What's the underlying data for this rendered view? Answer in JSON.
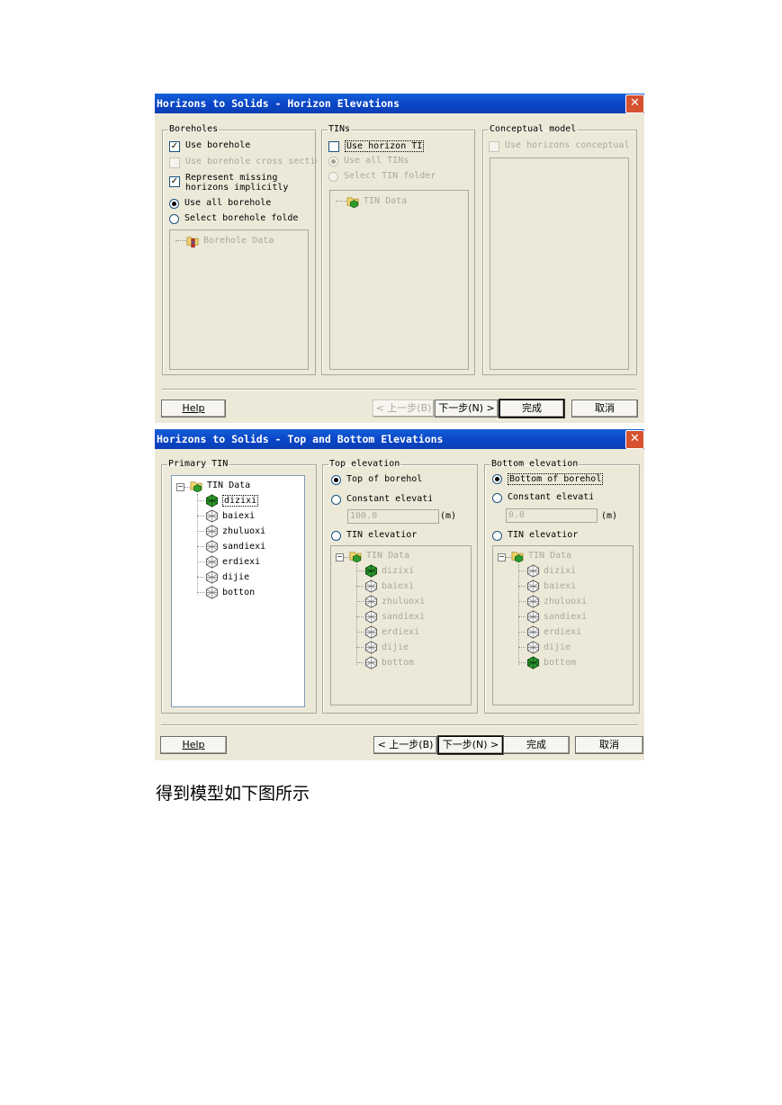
{
  "dialog1": {
    "title": "Horizons to Solids - Horizon Elevations",
    "close_glyph": "✕",
    "boreholes": {
      "legend": "Boreholes",
      "use_borehole": "Use borehole",
      "use_cross_sections": "Use borehole cross sectior",
      "represent_missing_line1": "Represent missing",
      "represent_missing_line2": "horizons implicitly",
      "use_all": "Use all borehole",
      "select_folder": "Select borehole folde",
      "tree_root": "Borehole Data"
    },
    "tins": {
      "legend": "TINs",
      "use_horizon": "Use horizon TI",
      "use_all": "Use all TINs",
      "select_folder": "Select TIN folder",
      "tree_root": "TIN Data"
    },
    "conceptual": {
      "legend": "Conceptual model",
      "use_horizons": "Use horizons conceptual m"
    },
    "buttons": {
      "help": "Help",
      "back": "< 上一步(B)",
      "next": "下一步(N) >",
      "finish": "完成",
      "cancel": "取消"
    }
  },
  "dialog2": {
    "title": "Horizons to Solids - Top and Bottom Elevations",
    "close_glyph": "✕",
    "primary": {
      "legend": "Primary TIN",
      "root": "TIN Data",
      "expander": "−",
      "items": [
        "dizixi",
        "baiexi",
        "zhuluoxi",
        "sandiexi",
        "erdiexi",
        "dijie",
        "botton"
      ]
    },
    "top": {
      "legend": "Top elevation",
      "top_of_borehole": "Top of borehol",
      "constant": "Constant elevati",
      "constant_value": "100.0",
      "unit": "(m)",
      "tin_elevation": "TIN elevatior",
      "tree_root": "TIN Data",
      "expander": "−",
      "items": [
        "dizixi",
        "baiexi",
        "zhuluoxi",
        "sandiexi",
        "erdiexi",
        "dijie",
        "bottom"
      ]
    },
    "bottom": {
      "legend": "Bottom elevation",
      "bottom_of_borehole": "Bottom of borehol",
      "constant": "Constant elevati",
      "constant_value": "0.0",
      "unit": "(m)",
      "tin_elevation": "TIN elevatior",
      "tree_root": "TIN Data",
      "expander": "−",
      "items": [
        "dizixi",
        "baiexi",
        "zhuluoxi",
        "sandiexi",
        "erdiexi",
        "dijie",
        "bottom"
      ]
    },
    "buttons": {
      "help": "Help",
      "back": "< 上一步(B)",
      "next": "下一步(N) >",
      "finish": "完成",
      "cancel": "取消"
    }
  },
  "caption": "得到模型如下图所示",
  "colors": {
    "title_blue": "#0a46c8",
    "dialog_bg": "#ece9d8",
    "tin_green": "#2e9a2e"
  }
}
